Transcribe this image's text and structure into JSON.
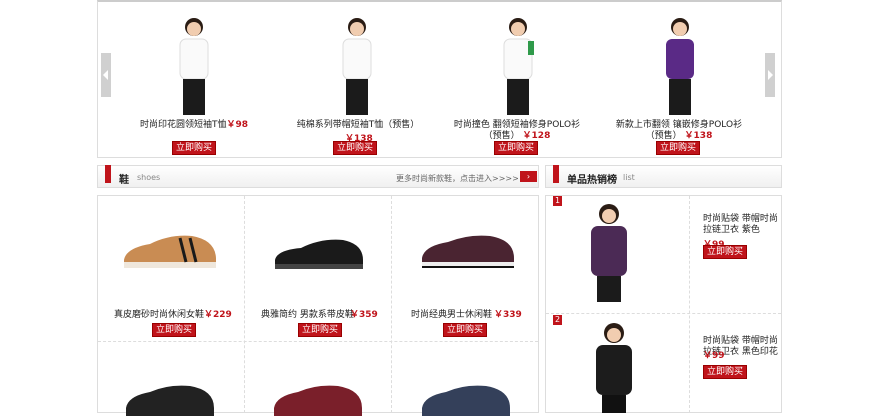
{
  "carousel": {
    "items": [
      {
        "title": "时尚印花圆领短袖T恤",
        "price": "￥98",
        "buy": "立即购买"
      },
      {
        "title": "纯棉系列带帽短袖T恤（预售）",
        "price": "￥138",
        "buy": "立即购买"
      },
      {
        "title": "时尚撞色 翻领短袖修身POLO衫（预售）",
        "price": "￥128",
        "buy": "立即购买"
      },
      {
        "title": "新款上市翻领 镶嵌修身POLO衫（预售）",
        "price": "￥138",
        "buy": "立即购买"
      }
    ]
  },
  "shoes": {
    "title": "鞋",
    "subtitle": "shoes",
    "more": "更多时尚新款鞋，点击进入>>>>",
    "items": [
      {
        "name": "真皮磨砂时尚休闲女鞋",
        "price": "￥229",
        "buy": "立即购买",
        "color": "#c98c53"
      },
      {
        "name": "典雅简约 男款系带皮鞋",
        "price": "￥359",
        "buy": "立即购买",
        "color": "#1a1a1a"
      },
      {
        "name": "时尚经典男士休闲鞋",
        "price": "￥339",
        "buy": "立即购买",
        "color": "#4a2431"
      },
      {
        "name": "",
        "price": "",
        "buy": "",
        "color": "#222"
      },
      {
        "name": "",
        "price": "",
        "buy": "",
        "color": "#7a1f2a"
      },
      {
        "name": "",
        "price": "",
        "buy": "",
        "color": "#34405a"
      }
    ]
  },
  "ranking": {
    "title": "单品热销榜",
    "subtitle": "list",
    "items": [
      {
        "rank": "1",
        "title": "时尚贴袋 带帽时尚拉链卫衣 紫色",
        "price": "￥99",
        "buy": "立即购买",
        "color": "#4b2a55"
      },
      {
        "rank": "2",
        "title": "时尚贴袋 带帽时尚拉链卫衣 黑色印花",
        "price": "￥99",
        "buy": "立即购买",
        "color": "#1c1c1c"
      }
    ]
  },
  "colors": {
    "accent": "#c0141b"
  }
}
